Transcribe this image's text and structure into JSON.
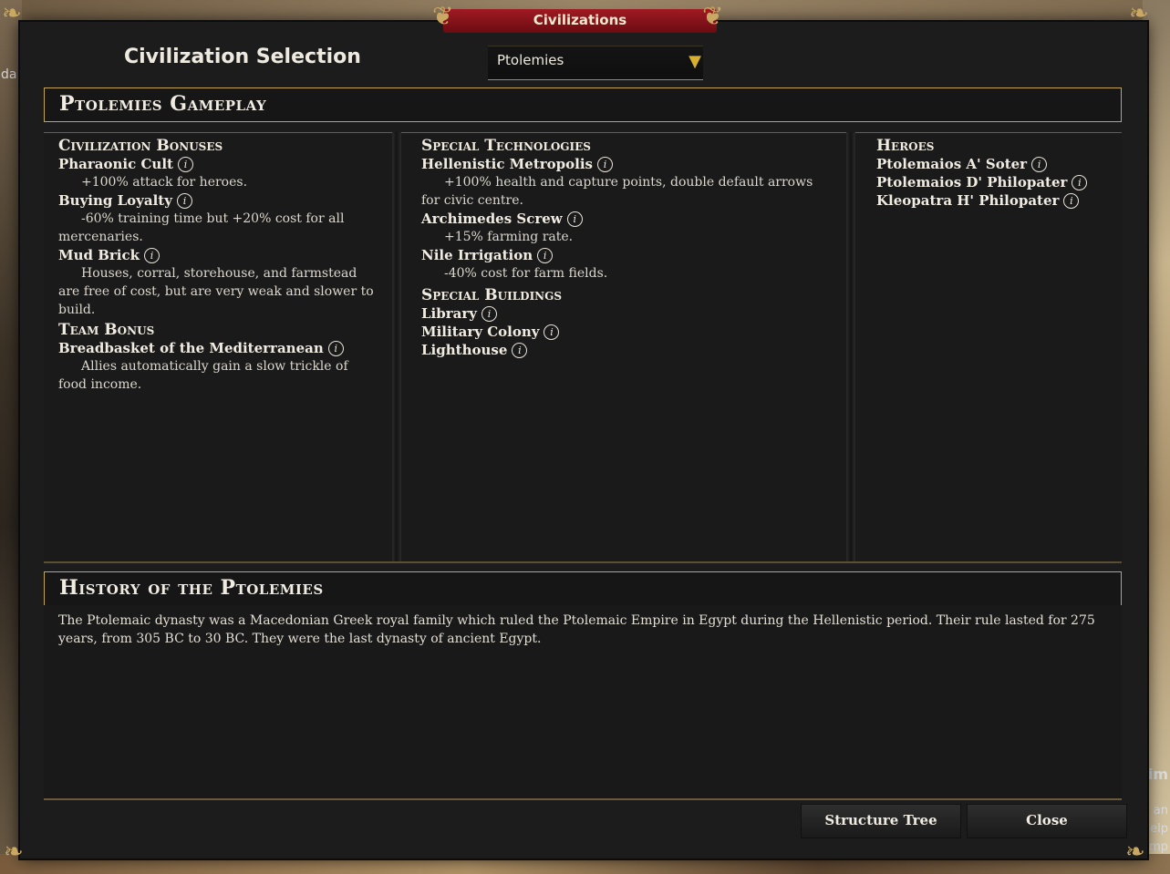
{
  "window": {
    "title": "Civilizations"
  },
  "header": {
    "title": "Civilization Selection"
  },
  "civ_dropdown": {
    "selected": "Ptolemies",
    "arrow_icon": "triangle-down-icon"
  },
  "gameplay": {
    "title": "Ptolemies Gameplay",
    "civ_bonuses": {
      "heading": "Civilization Bonuses",
      "items": [
        {
          "name": "Pharaonic Cult",
          "desc": "+100% attack for heroes."
        },
        {
          "name": "Buying Loyalty",
          "desc": "-60% training time but +20% cost for all mercenaries."
        },
        {
          "name": "Mud Brick",
          "desc": "Houses, corral, storehouse, and farmstead are free of cost, but are very weak and slower to build."
        }
      ]
    },
    "team_bonus": {
      "heading": "Team Bonus",
      "items": [
        {
          "name": "Breadbasket of the Mediterranean",
          "desc": "Allies automatically gain a slow trickle of food income."
        }
      ]
    },
    "special_techs": {
      "heading": "Special Technologies",
      "items": [
        {
          "name": "Hellenistic Metropolis",
          "desc": "+100% health and capture points, double default arrows for civic centre."
        },
        {
          "name": "Archimedes Screw",
          "desc": "+15% farming rate."
        },
        {
          "name": "Nile Irrigation",
          "desc": "-40% cost for farm fields."
        }
      ]
    },
    "special_buildings": {
      "heading": "Special Buildings",
      "items": [
        "Library",
        "Military Colony",
        "Lighthouse"
      ]
    },
    "heroes": {
      "heading": "Heroes",
      "items": [
        "Ptolemaios A' Soter",
        "Ptolemaios D' Philopater",
        "Kleopatra H' Philopater"
      ]
    }
  },
  "history": {
    "title": "History of the Ptolemies",
    "text": "The Ptolemaic dynasty was a Macedonian Greek royal family which ruled the Ptolemaic Empire in Egypt during the Hellenistic period. Their rule lasted for 275 years, from 305 BC to 30 BC. They were the last dynasty of ancient Egypt."
  },
  "buttons": {
    "structure_tree": "Structure Tree",
    "close": "Close"
  },
  "background": {
    "left_fragment": "da",
    "right_fragments": [
      "im",
      "an",
      "elp",
      "mp"
    ]
  },
  "info_icon": "i",
  "colors": {
    "accent_gold": "#c4a64f",
    "title_red": "#a01a22",
    "panel": "#1c1c1c"
  }
}
